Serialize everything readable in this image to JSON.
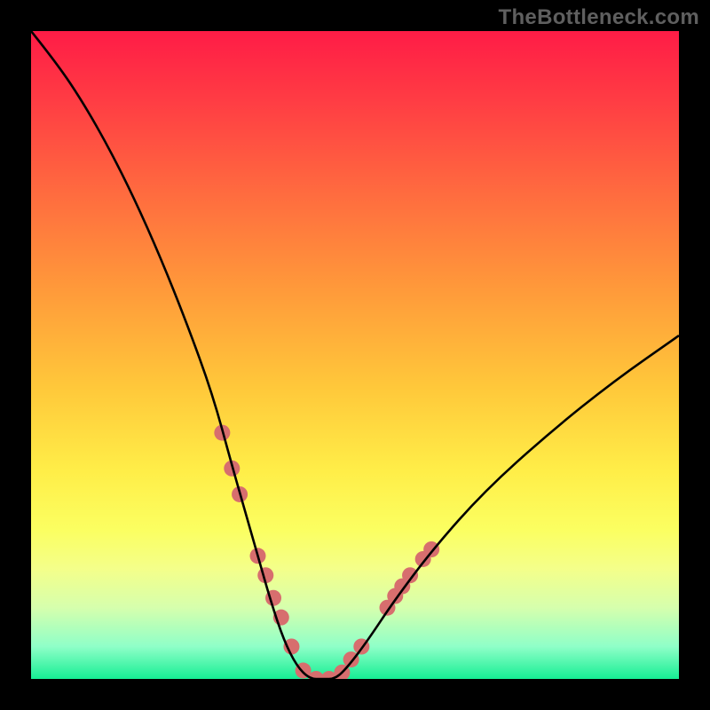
{
  "watermark": "TheBottleneck.com",
  "chart_data": {
    "type": "line",
    "title": "",
    "xlabel": "",
    "ylabel": "",
    "xlim": [
      0,
      100
    ],
    "ylim": [
      0,
      100
    ],
    "grid": false,
    "series": [
      {
        "name": "bottleneck-curve",
        "x": [
          0,
          4,
          8,
          12,
          16,
          20,
          24,
          28,
          31,
          33,
          35,
          37,
          39,
          41,
          43,
          45,
          47,
          49,
          52,
          56,
          62,
          70,
          80,
          90,
          100
        ],
        "values": [
          100,
          95,
          89,
          82,
          74,
          65,
          55,
          44,
          33,
          26,
          19,
          12,
          6,
          2,
          0,
          0,
          0,
          2,
          6,
          12,
          20,
          29,
          38,
          46,
          53
        ]
      }
    ],
    "dots": {
      "name": "markers",
      "color": "#d76e6e",
      "radius_px": 9,
      "x": [
        29.5,
        31.0,
        32.2,
        35.0,
        36.2,
        37.4,
        38.6,
        40.2,
        42.0,
        44.0,
        46.0,
        48.0,
        49.4,
        51.0,
        55.0,
        56.2,
        57.3,
        58.5,
        60.5,
        61.8
      ],
      "values": [
        38.0,
        32.5,
        28.5,
        19.0,
        16.0,
        12.5,
        9.5,
        5.0,
        1.3,
        0.0,
        0.0,
        1.0,
        3.0,
        5.0,
        11.0,
        12.8,
        14.3,
        16.0,
        18.5,
        20.0
      ]
    }
  }
}
